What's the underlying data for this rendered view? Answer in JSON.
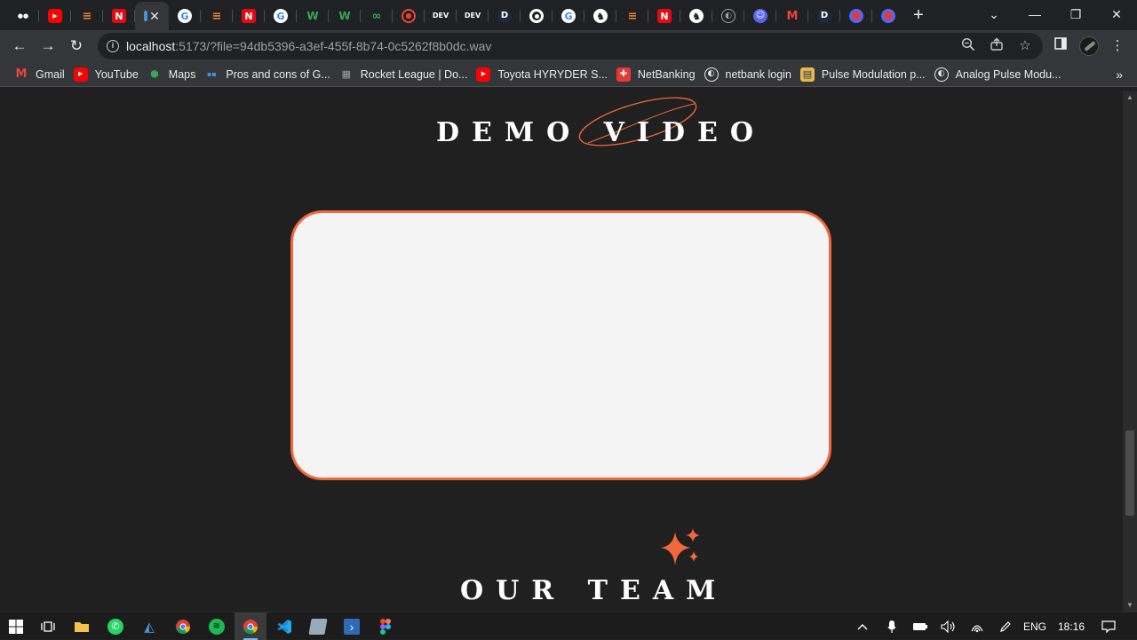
{
  "browser": {
    "tabs": [
      {
        "icon": "medium-icon",
        "color": "#ffffff"
      },
      {
        "icon": "youtube-icon",
        "color": "#ff0000"
      },
      {
        "icon": "stackoverflow-icon",
        "color": "#f48024"
      },
      {
        "icon": "netflix-icon",
        "color": "#e50914"
      },
      {
        "icon": "localhost-icon",
        "color": "#4a90d9",
        "active": true
      },
      {
        "icon": "google-icon",
        "color": "#ffffff"
      },
      {
        "icon": "stackoverflow-icon",
        "color": "#f48024"
      },
      {
        "icon": "netflix-icon",
        "color": "#e50914"
      },
      {
        "icon": "google-icon",
        "color": "#ffffff"
      },
      {
        "icon": "webflow-icon",
        "color": "#34a853"
      },
      {
        "icon": "webflow-icon",
        "color": "#34a853"
      },
      {
        "icon": "glasses-icon",
        "color": "#34a853"
      },
      {
        "icon": "record-icon",
        "color": "#ea4335"
      },
      {
        "icon": "dev-icon",
        "color": "#ffffff",
        "label": "DEV"
      },
      {
        "icon": "dev-icon",
        "color": "#ffffff",
        "label": "DEV"
      },
      {
        "icon": "d-icon",
        "color": "#1a73e8",
        "label": "D"
      },
      {
        "icon": "chrome-icon",
        "color": "#ffffff"
      },
      {
        "icon": "google-icon",
        "color": "#ffffff"
      },
      {
        "icon": "github-icon",
        "color": "#ffffff"
      },
      {
        "icon": "stackoverflow-icon",
        "color": "#f48024"
      },
      {
        "icon": "netflix-icon",
        "color": "#e50914"
      },
      {
        "icon": "github-icon",
        "color": "#ffffff"
      },
      {
        "icon": "globe-icon",
        "color": "#9aa0a6"
      },
      {
        "icon": "discord-icon",
        "color": "#5865f2"
      },
      {
        "icon": "gmail-icon",
        "color": "#ea4335"
      },
      {
        "icon": "d-icon",
        "color": "#1a73e8",
        "label": "D"
      },
      {
        "icon": "bug-icon",
        "color": "#5865f2"
      },
      {
        "icon": "bug-icon",
        "color": "#5865f2"
      }
    ],
    "url_host": "localhost",
    "url_rest": ":5173/?file=94db5396-a3ef-455f-8b74-0c5262f8b0dc.wav",
    "bookmarks": [
      {
        "label": "Gmail",
        "icon": "gmail-icon",
        "color": "#ea4335"
      },
      {
        "label": "YouTube",
        "icon": "youtube-icon",
        "color": "#ff0000"
      },
      {
        "label": "Maps",
        "icon": "maps-icon",
        "color": "#34a853"
      },
      {
        "label": "Pros and cons of G...",
        "icon": "bookmark-site-icon",
        "color": "#4a90d9"
      },
      {
        "label": "Rocket League | Do...",
        "icon": "rocket-league-icon",
        "color": "#9aa0a6"
      },
      {
        "label": "Toyota HYRYDER S...",
        "icon": "youtube-icon",
        "color": "#ff0000"
      },
      {
        "label": "NetBanking",
        "icon": "netbanking-icon",
        "color": "#e53935"
      },
      {
        "label": "netbank login",
        "icon": "globe-icon",
        "color": "#e8eaed"
      },
      {
        "label": "Pulse Modulation p...",
        "icon": "pulse-icon",
        "color": "#4a90d9"
      },
      {
        "label": "Analog Pulse Modu...",
        "icon": "globe-icon",
        "color": "#e8eaed"
      }
    ]
  },
  "page": {
    "demo_heading": "DEMO VIDEO",
    "team_heading": "OUR TEAM",
    "accent": "#f0683c",
    "video_bg": "#f4f4f4"
  },
  "taskbar": {
    "apps": [
      {
        "name": "start-button",
        "icon": "windows-icon"
      },
      {
        "name": "task-view-button",
        "icon": "task-view-icon"
      },
      {
        "name": "file-explorer-button",
        "icon": "folder-icon",
        "color": "#f2c14e"
      },
      {
        "name": "whatsapp-button",
        "icon": "whatsapp-icon",
        "color": "#25d366"
      },
      {
        "name": "app-button",
        "icon": "app-icon",
        "color": "#4a90d9"
      },
      {
        "name": "chrome-button",
        "icon": "chrome-icon"
      },
      {
        "name": "spotify-button",
        "icon": "spotify-icon",
        "color": "#1db954"
      },
      {
        "name": "chrome-active-button",
        "icon": "chrome-icon",
        "active": true
      },
      {
        "name": "vscode-button",
        "icon": "vscode-icon",
        "color": "#23a9f2"
      },
      {
        "name": "notes-button",
        "icon": "notes-icon",
        "color": "#9ab"
      },
      {
        "name": "powershell-button",
        "icon": "powershell-icon",
        "color": "#2c6bb8"
      },
      {
        "name": "figma-button",
        "icon": "figma-icon",
        "color": "#f24e1e"
      }
    ],
    "language": "ENG",
    "time": "18:16"
  }
}
